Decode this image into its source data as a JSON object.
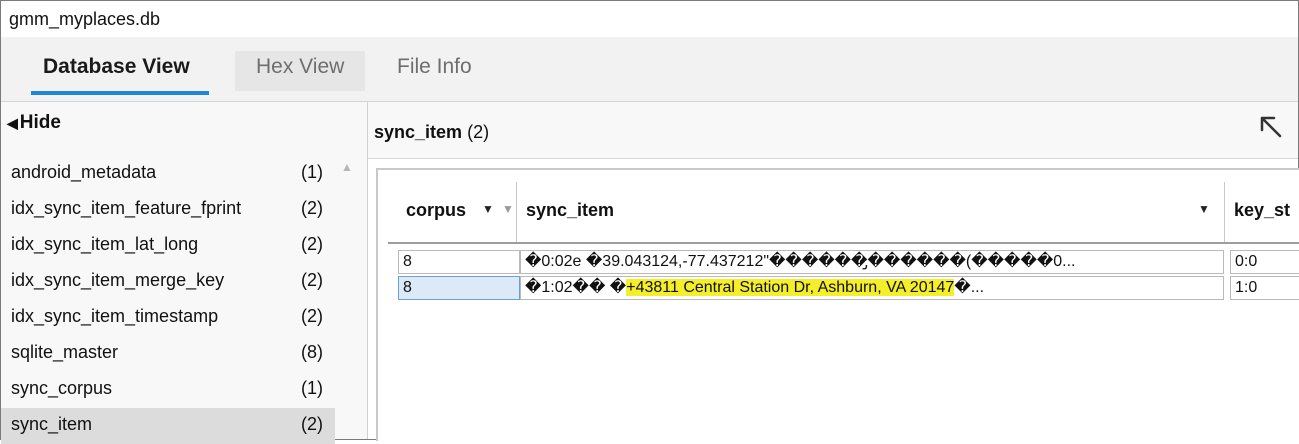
{
  "window": {
    "title": "gmm_myplaces.db"
  },
  "tabs": [
    {
      "label": "Database View",
      "active": true
    },
    {
      "label": "Hex View",
      "active": false
    },
    {
      "label": "File Info",
      "active": false
    }
  ],
  "left_panel": {
    "hide_label": "Hide",
    "tables": [
      {
        "name": "android_metadata",
        "count": "(1)"
      },
      {
        "name": "idx_sync_item_feature_fprint",
        "count": "(2)"
      },
      {
        "name": "idx_sync_item_lat_long",
        "count": "(2)"
      },
      {
        "name": "idx_sync_item_merge_key",
        "count": "(2)"
      },
      {
        "name": "idx_sync_item_timestamp",
        "count": "(2)"
      },
      {
        "name": "sqlite_master",
        "count": "(8)"
      },
      {
        "name": "sync_corpus",
        "count": "(1)"
      },
      {
        "name": "sync_item",
        "count": "(2)",
        "selected": true
      }
    ]
  },
  "table_view": {
    "table_name": "sync_item",
    "row_count": "(2)",
    "columns": [
      "corpus",
      "sync_item",
      "key_st"
    ],
    "rows": [
      {
        "corpus": "8",
        "sync_item_pre": "�0:02e �39.043124,-77.437212\"������̡������(�����0...",
        "sync_item_hl": "",
        "sync_item_post": "",
        "key": "0:0"
      },
      {
        "corpus": "8",
        "sync_item_pre": "�1:02�� �",
        "sync_item_hl": "+43811 Central Station Dr, Ashburn, VA 20147",
        "sync_item_post": "�...",
        "key": "1:0"
      }
    ]
  },
  "colors": {
    "accent": "#1f86d8",
    "highlight": "#f4ef2a"
  }
}
